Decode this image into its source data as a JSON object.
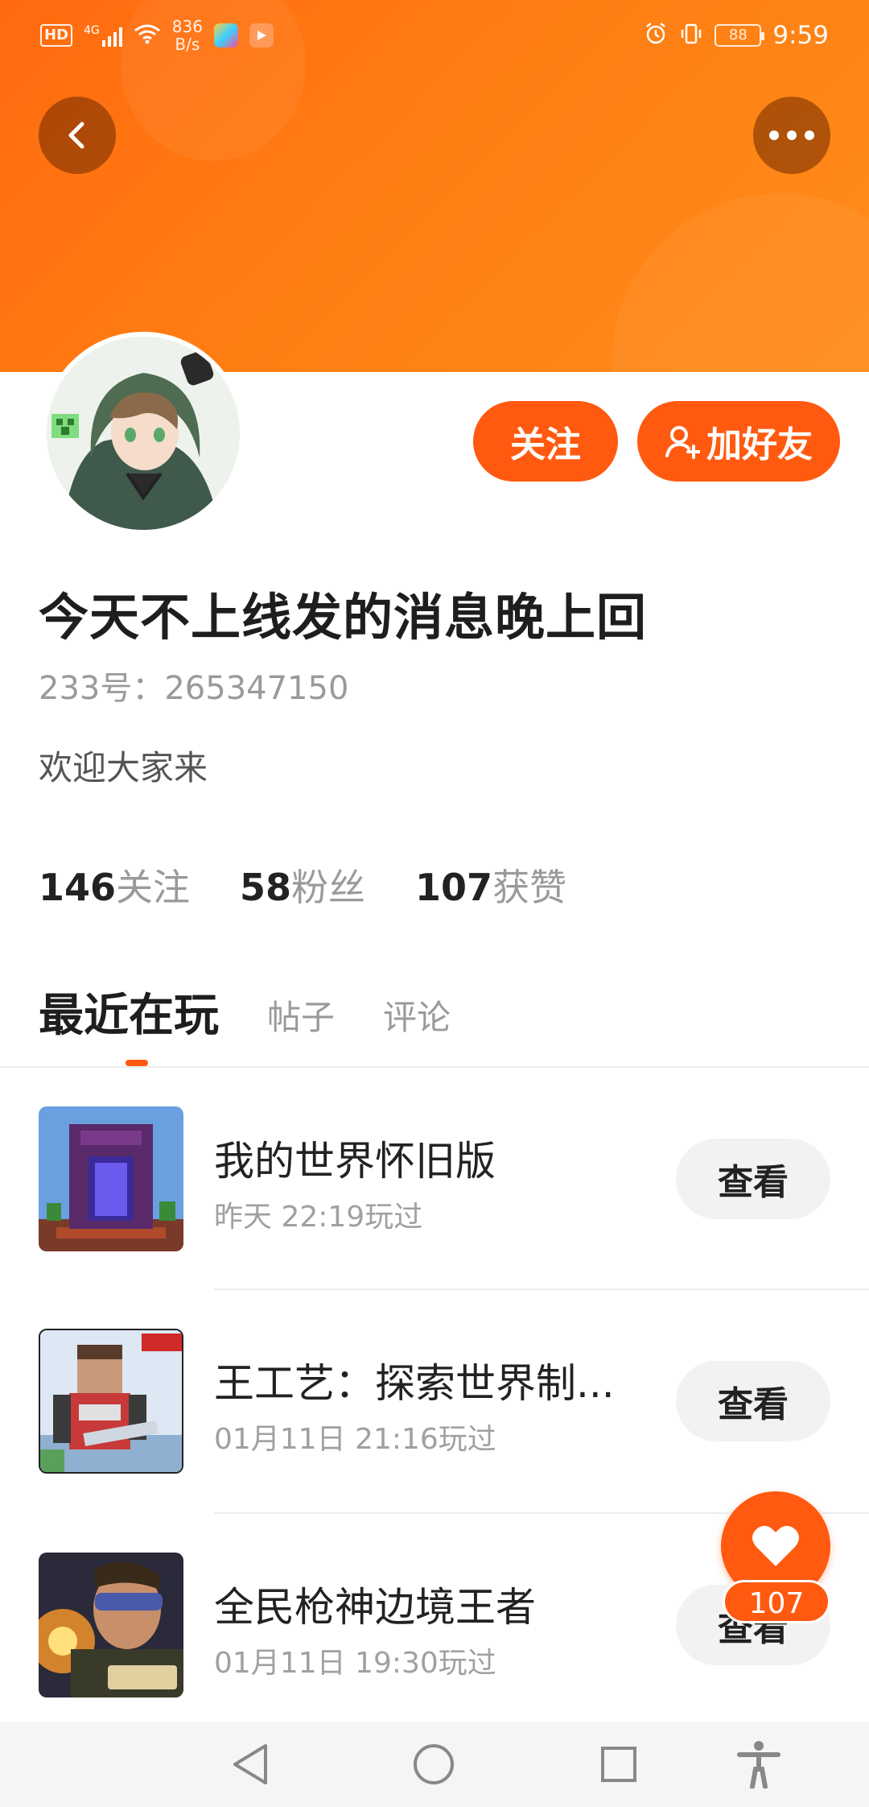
{
  "status_bar": {
    "hd": "HD",
    "network": "4G",
    "speed_top": "836",
    "speed_bottom": "B/s",
    "battery": "88",
    "time": "9:59"
  },
  "header": {
    "back_icon": "chevron-left-icon",
    "more_icon": "more-dots-icon",
    "accent": "#ff5a10"
  },
  "profile": {
    "follow_label": "关注",
    "add_friend_label": "加好友",
    "nickname": "今天不上线发的消息晚上回",
    "uid": "233号：265347150",
    "bio": "欢迎大家来",
    "stats": [
      {
        "num": "146",
        "label": "关注"
      },
      {
        "num": "58",
        "label": "粉丝"
      },
      {
        "num": "107",
        "label": "获赞"
      }
    ]
  },
  "tabs": [
    {
      "label": "最近在玩",
      "active": true
    },
    {
      "label": "帖子",
      "active": false
    },
    {
      "label": "评论",
      "active": false
    }
  ],
  "games": [
    {
      "name": "我的世界怀旧版",
      "time": "昨天 22:19玩过",
      "button": "查看"
    },
    {
      "name": "王工艺：探索世界制...",
      "time": "01月11日 21:16玩过",
      "button": "查看"
    },
    {
      "name": "全民枪神边境王者",
      "time": "01月11日 19:30玩过",
      "button": "查看"
    }
  ],
  "like_fab": {
    "count": "107",
    "icon": "heart-icon"
  },
  "navbar": {
    "icons": [
      "back-triangle-icon",
      "home-circle-icon",
      "recents-square-icon",
      "accessibility-icon"
    ]
  }
}
